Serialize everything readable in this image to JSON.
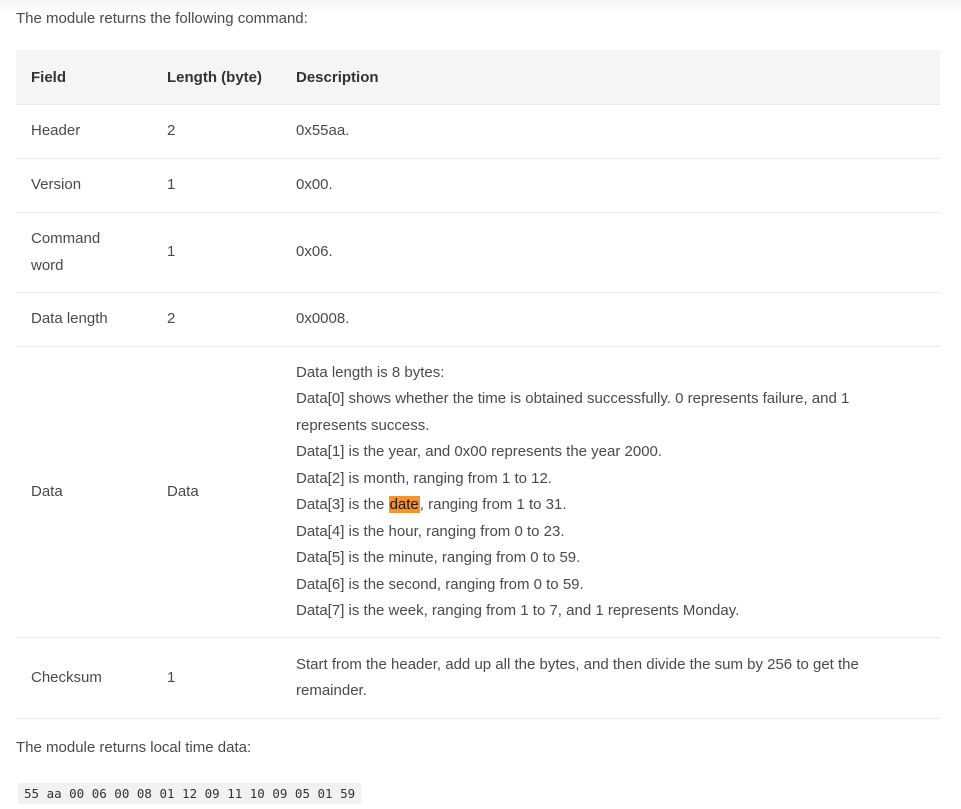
{
  "intro_text": "The module returns the following command:",
  "table": {
    "headers": [
      "Field",
      "Length (byte)",
      "Description"
    ],
    "rows": [
      {
        "field": "Header",
        "length": "2",
        "description": "0x55aa."
      },
      {
        "field": "Version",
        "length": "1",
        "description": "0x00."
      },
      {
        "field": "Command word",
        "length": "1",
        "description": "0x06."
      },
      {
        "field": "Data length",
        "length": "2",
        "description": "0x0008."
      },
      {
        "field": "Data",
        "length": "Data",
        "description_lines": [
          "Data length is 8 bytes:",
          "Data[0] shows whether the time is obtained successfully. 0 represents failure, and 1 represents success.",
          "Data[1] is the year, and 0x00 represents the year 2000.",
          "Data[2] is month, ranging from 1 to 12.",
          {
            "before": "Data[3] is the ",
            "highlight": "date",
            "after": ", ranging from 1 to 31."
          },
          "Data[4] is the hour, ranging from 0 to 23.",
          "Data[5] is the minute, ranging from 0 to 59.",
          "Data[6] is the second, ranging from 0 to 59.",
          "Data[7] is the week, ranging from 1 to 7, and 1 represents Monday."
        ]
      },
      {
        "field": "Checksum",
        "length": "1",
        "description": "Start from the header, add up all the bytes, and then divide the sum by 256 to get the remainder."
      }
    ]
  },
  "after_text": "The module returns local time data:",
  "code_sample": "55 aa 00 06 00 08 01 12 09 11 10 09 05 01 59",
  "colors": {
    "header_bg": "#f4f5f6",
    "highlight": "#f7932c",
    "code_bg": "#f1f1f1",
    "border": "#e8e8e8"
  }
}
